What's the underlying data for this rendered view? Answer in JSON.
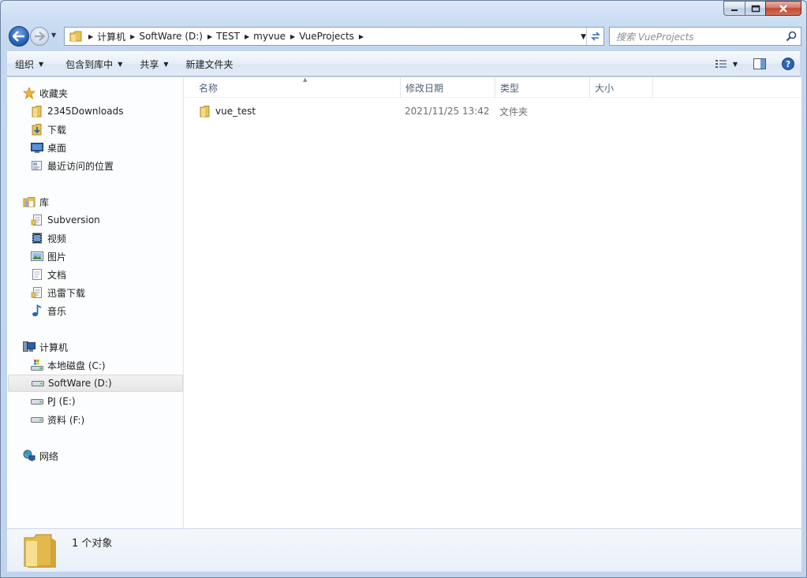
{
  "window": {
    "caption_buttons": [
      "minimize",
      "maximize",
      "close"
    ]
  },
  "nav": {
    "breadcrumbs": [
      "计算机",
      "SoftWare (D:)",
      "TEST",
      "myvue",
      "VueProjects"
    ],
    "search_placeholder": "搜索 VueProjects"
  },
  "toolbar": {
    "organize": "组织",
    "include_in_library": "包含到库中",
    "share": "共享",
    "new_folder": "新建文件夹"
  },
  "sidebar": {
    "favorites": {
      "label": "收藏夹",
      "icon": "star-icon"
    },
    "favorites_items": [
      {
        "label": "2345Downloads",
        "icon": "folder-icon"
      },
      {
        "label": "下载",
        "icon": "downloads-icon"
      },
      {
        "label": "桌面",
        "icon": "desktop-icon"
      },
      {
        "label": "最近访问的位置",
        "icon": "recent-places-icon"
      }
    ],
    "libraries": {
      "label": "库",
      "icon": "library-icon"
    },
    "libraries_items": [
      {
        "label": "Subversion",
        "icon": "library-document-icon"
      },
      {
        "label": "视频",
        "icon": "video-icon"
      },
      {
        "label": "图片",
        "icon": "picture-icon"
      },
      {
        "label": "文档",
        "icon": "document-icon"
      },
      {
        "label": "迅雷下载",
        "icon": "library-document-icon"
      },
      {
        "label": "音乐",
        "icon": "music-icon"
      }
    ],
    "computer": {
      "label": "计算机",
      "icon": "computer-icon"
    },
    "computer_items": [
      {
        "label": "本地磁盘 (C:)",
        "icon": "system-drive-icon"
      },
      {
        "label": "SoftWare (D:)",
        "icon": "drive-icon",
        "selected": true
      },
      {
        "label": "PJ (E:)",
        "icon": "drive-icon"
      },
      {
        "label": "资料 (F:)",
        "icon": "drive-icon"
      }
    ],
    "network": {
      "label": "网络",
      "icon": "network-icon"
    }
  },
  "columns": {
    "name": "名称",
    "modified": "修改日期",
    "type": "类型",
    "size": "大小"
  },
  "files": [
    {
      "name": "vue_test",
      "modified": "2021/11/25 13:42",
      "type": "文件夹",
      "size": ""
    }
  ],
  "details": {
    "status": "1 个对象"
  },
  "colors": {
    "selection": "#e6e6e6",
    "header_text": "#4c607a",
    "chrome": "#c5d8ee"
  }
}
